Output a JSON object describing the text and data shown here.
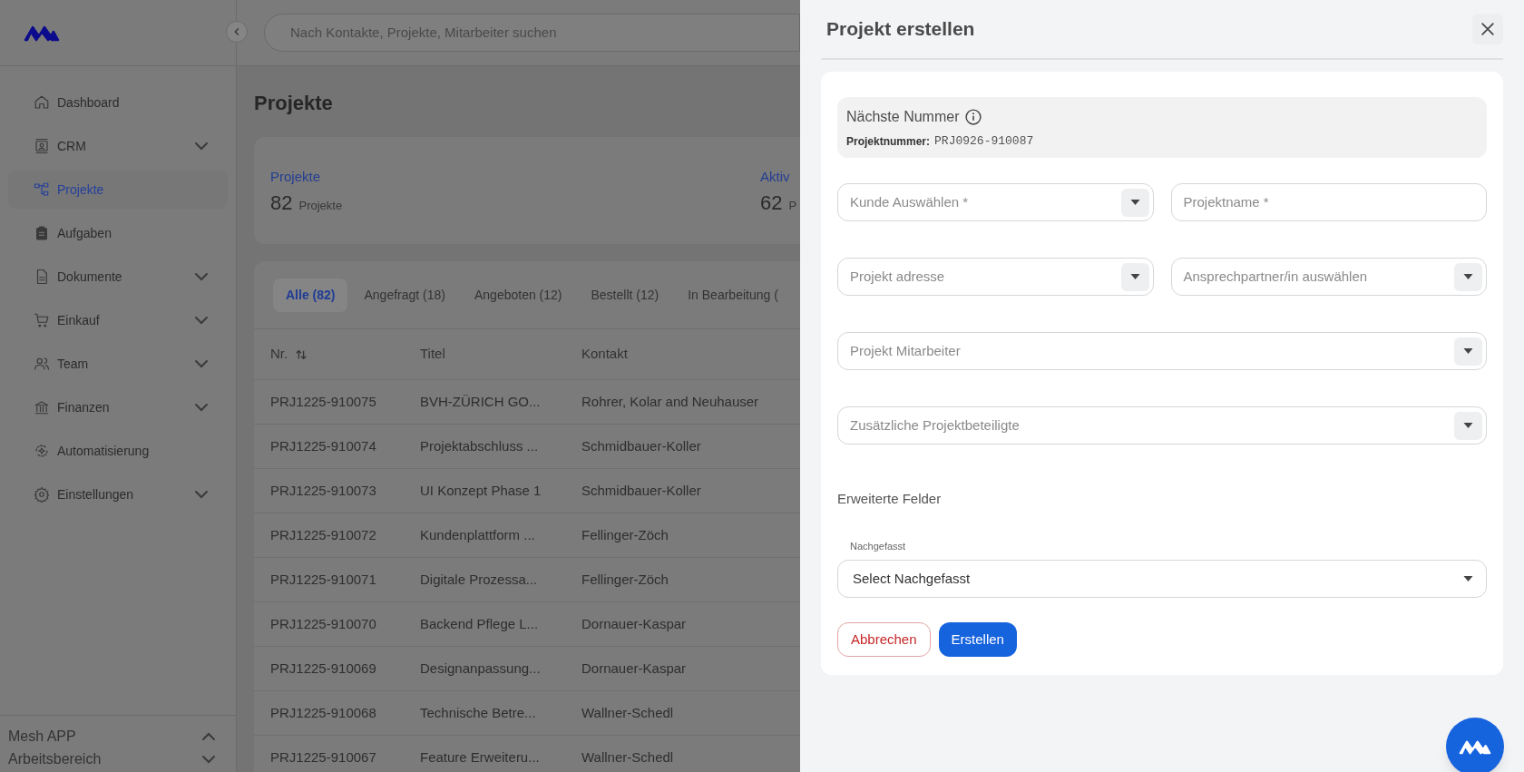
{
  "sidebar": {
    "items": [
      {
        "label": "Dashboard",
        "selected": false,
        "expandable": false
      },
      {
        "label": "CRM",
        "selected": false,
        "expandable": true
      },
      {
        "label": "Projekte",
        "selected": true,
        "expandable": false
      },
      {
        "label": "Aufgaben",
        "selected": false,
        "expandable": false
      },
      {
        "label": "Dokumente",
        "selected": false,
        "expandable": true
      },
      {
        "label": "Einkauf",
        "selected": false,
        "expandable": true
      },
      {
        "label": "Team",
        "selected": false,
        "expandable": true
      },
      {
        "label": "Finanzen",
        "selected": false,
        "expandable": true
      },
      {
        "label": "Automatisierung",
        "selected": false,
        "expandable": false
      },
      {
        "label": "Einstellungen",
        "selected": false,
        "expandable": true
      }
    ],
    "footer": [
      {
        "label": "Mesh APP",
        "expanded": true
      },
      {
        "label": "Arbeitsbereich",
        "expanded": false
      }
    ]
  },
  "search": {
    "placeholder": "Nach Kontakte, Projekte, Mitarbeiter suchen"
  },
  "page_title": "Projekte",
  "stats": [
    {
      "label": "Projekte",
      "value": "82",
      "unit": "Projekte"
    },
    {
      "label": "Aktiv",
      "value": "62",
      "unit": "P"
    }
  ],
  "tabs": [
    {
      "label": "Alle (82)",
      "selected": true
    },
    {
      "label": "Angefragt (18)",
      "selected": false
    },
    {
      "label": "Angeboten (12)",
      "selected": false
    },
    {
      "label": "Bestellt (12)",
      "selected": false
    },
    {
      "label": "In Bearbeitung (",
      "selected": false
    }
  ],
  "table": {
    "columns": [
      {
        "label": "Nr.",
        "sortable": true
      },
      {
        "label": "Titel",
        "sortable": false
      },
      {
        "label": "Kontakt",
        "sortable": false
      }
    ],
    "rows": [
      [
        "PRJ1225-910075",
        "BVH-ZÜRICH GO...",
        "Rohrer, Kolar and Neuhauser"
      ],
      [
        "PRJ1225-910074",
        "Projektabschluss ...",
        "Schmidbauer-Koller"
      ],
      [
        "PRJ1225-910073",
        "UI Konzept Phase 1",
        "Schmidbauer-Koller"
      ],
      [
        "PRJ1225-910072",
        "Kundenplattform ...",
        "Fellinger-Zöch"
      ],
      [
        "PRJ1225-910071",
        "Digitale Prozessa...",
        "Fellinger-Zöch"
      ],
      [
        "PRJ1225-910070",
        "Backend Pflege L...",
        "Dornauer-Kaspar"
      ],
      [
        "PRJ1225-910069",
        "Designanpassung...",
        "Dornauer-Kaspar"
      ],
      [
        "PRJ1225-910068",
        "Technische Betre...",
        "Wallner-Schedl"
      ],
      [
        "PRJ1225-910067",
        "Feature Erweiteru...",
        "Wallner-Schedl"
      ]
    ]
  },
  "drawer": {
    "title": "Projekt erstellen",
    "next_number": {
      "title": "Nächste Nummer",
      "label": "Projektnummer:",
      "value": "PRJ0926-910087"
    },
    "field_rows": [
      [
        {
          "kind": "select",
          "placeholder": "Kunde Auswählen *"
        },
        {
          "kind": "text",
          "placeholder": "Projektname *"
        }
      ],
      [
        {
          "kind": "select",
          "placeholder": "Projekt adresse"
        },
        {
          "kind": "select",
          "placeholder": "Ansprechpartner/in auswählen"
        }
      ],
      [
        {
          "kind": "select",
          "placeholder": "Projekt Mitarbeiter"
        }
      ],
      [
        {
          "kind": "select",
          "placeholder": "Zusätzliche Projektbeteiligte"
        }
      ]
    ],
    "extended": {
      "title": "Erweiterte Felder",
      "label": "Nachgefasst",
      "value": "Select Nachgefasst"
    },
    "buttons": [
      {
        "label": "Abbrechen",
        "kind": "secondary"
      },
      {
        "label": "Erstellen",
        "kind": "primary"
      }
    ]
  }
}
